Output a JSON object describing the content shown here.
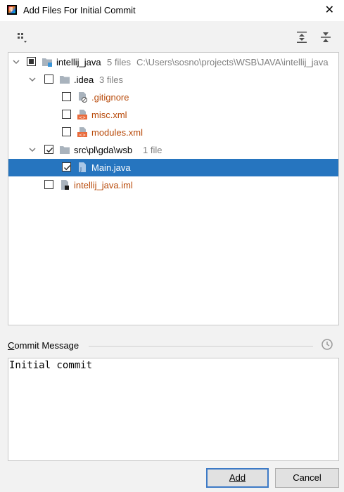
{
  "window": {
    "title": "Add Files For Initial Commit",
    "close_glyph": "✕"
  },
  "toolbar": {
    "group_by_icon": "group-by-icon",
    "expand_all_icon": "expand-all-icon",
    "collapse_all_icon": "collapse-all-icon"
  },
  "tree": {
    "root": {
      "name": "intellij_java",
      "count": "5 files",
      "path": "C:\\Users\\sosno\\projects\\WSB\\JAVA\\intellij_java",
      "checked": "partial"
    },
    "idea": {
      "name": ".idea",
      "count": "3 files",
      "checked": false
    },
    "gitignore": {
      "name": ".gitignore",
      "checked": false
    },
    "misc": {
      "name": "misc.xml",
      "checked": false
    },
    "modules": {
      "name": "modules.xml",
      "checked": false
    },
    "src": {
      "name": "src\\pl\\gda\\wsb",
      "count": "1 file",
      "checked": true
    },
    "main": {
      "name": "Main.java",
      "checked": true,
      "selected": true
    },
    "iml": {
      "name": "intellij_java.iml",
      "checked": false
    }
  },
  "commit": {
    "label": "Commit Message",
    "message": "Initial commit"
  },
  "buttons": {
    "add": "Add",
    "cancel": "Cancel"
  },
  "colors": {
    "selection": "#2675bf",
    "unversioned_text": "#b84a0a",
    "folder": "#a9b3bd",
    "primary_border": "#3d7ac6"
  }
}
